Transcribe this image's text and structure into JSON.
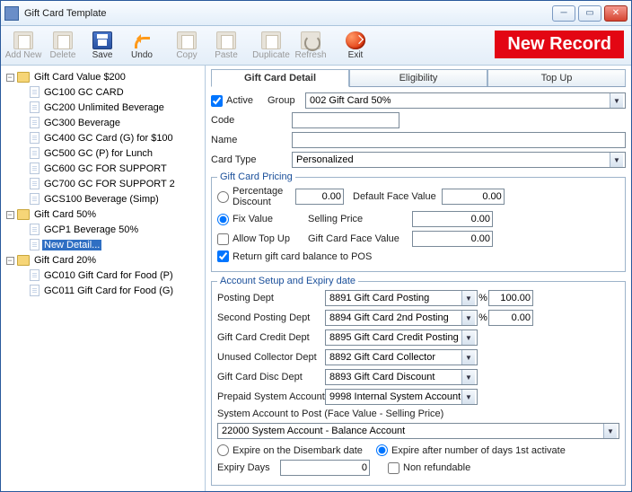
{
  "window": {
    "title": "Gift Card Template"
  },
  "toolbar": {
    "addnew": "Add New",
    "delete": "Delete",
    "save": "Save",
    "undo": "Undo",
    "copy": "Copy",
    "paste": "Paste",
    "duplicate": "Duplicate",
    "refresh": "Refresh",
    "exit": "Exit"
  },
  "badge": "New Record",
  "tree": {
    "n0": "Gift Card Value $200",
    "n0c": [
      "GC100 GC CARD",
      "GC200 Unlimited Beverage",
      "GC300 Beverage",
      "GC400 GC Card (G) for $100",
      "GC500 GC (P) for Lunch",
      "GC600 GC FOR SUPPORT",
      "GC700 GC FOR SUPPORT 2",
      "GCS100 Beverage (Simp)"
    ],
    "n1": "Gift Card 50%",
    "n1c": [
      "GCP1 Beverage 50%",
      "New Detail..."
    ],
    "n2": "Gift Card 20%",
    "n2c": [
      "GC010 Gift Card for Food (P)",
      "GC011 Gift Card for Food (G)"
    ]
  },
  "tabs": {
    "detail": "Gift Card Detail",
    "elig": "Eligibility",
    "topup": "Top Up"
  },
  "detail": {
    "active_label": "Active",
    "active": true,
    "group_label": "Group",
    "group_value": "002   Gift Card 50%",
    "code_label": "Code",
    "code_value": "",
    "name_label": "Name",
    "name_value": "",
    "cardtype_label": "Card Type",
    "cardtype_value": "Personalized",
    "pricing": {
      "legend": "Gift Card Pricing",
      "pct_label": "Percentage Discount",
      "pct_value": "0.00",
      "default_face_label": "Default Face Value",
      "default_face_value": "0.00",
      "fix_label": "Fix Value",
      "selling_label": "Selling Price",
      "selling_value": "0.00",
      "allow_topup_label": "Allow Top Up",
      "face_label": "Gift Card Face Value",
      "face_value": "0.00",
      "return_label": "Return gift card balance to POS"
    },
    "acct": {
      "legend": "Account Setup and Expiry date",
      "posting_label": "Posting Dept",
      "posting_value": "8891 Gift Card Posting",
      "posting_pct": "100.00",
      "second_label": "Second Posting Dept",
      "second_value": "8894 Gift Card 2nd Posting",
      "second_pct": "0.00",
      "credit_label": "Gift Card Credit Dept",
      "credit_value": "8895 Gift Card Credit Posting",
      "unused_label": "Unused Collector Dept",
      "unused_value": "8892 Gift Card Collector",
      "disc_label": "Gift Card Disc Dept",
      "disc_value": "8893 Gift Card Discount",
      "prepaid_label": "Prepaid System Account",
      "prepaid_value": "9998 Internal System Account",
      "syspost_label": "System Account to Post (Face Value - Selling Price)",
      "syspost_value": "22000 System Account - Balance Account",
      "exp_disembark": "Expire on the Disembark date",
      "exp_days_activate": "Expire after number of days 1st activate",
      "expiry_days_label": "Expiry Days",
      "expiry_days_value": "0",
      "nonref_label": "Non refundable"
    }
  }
}
